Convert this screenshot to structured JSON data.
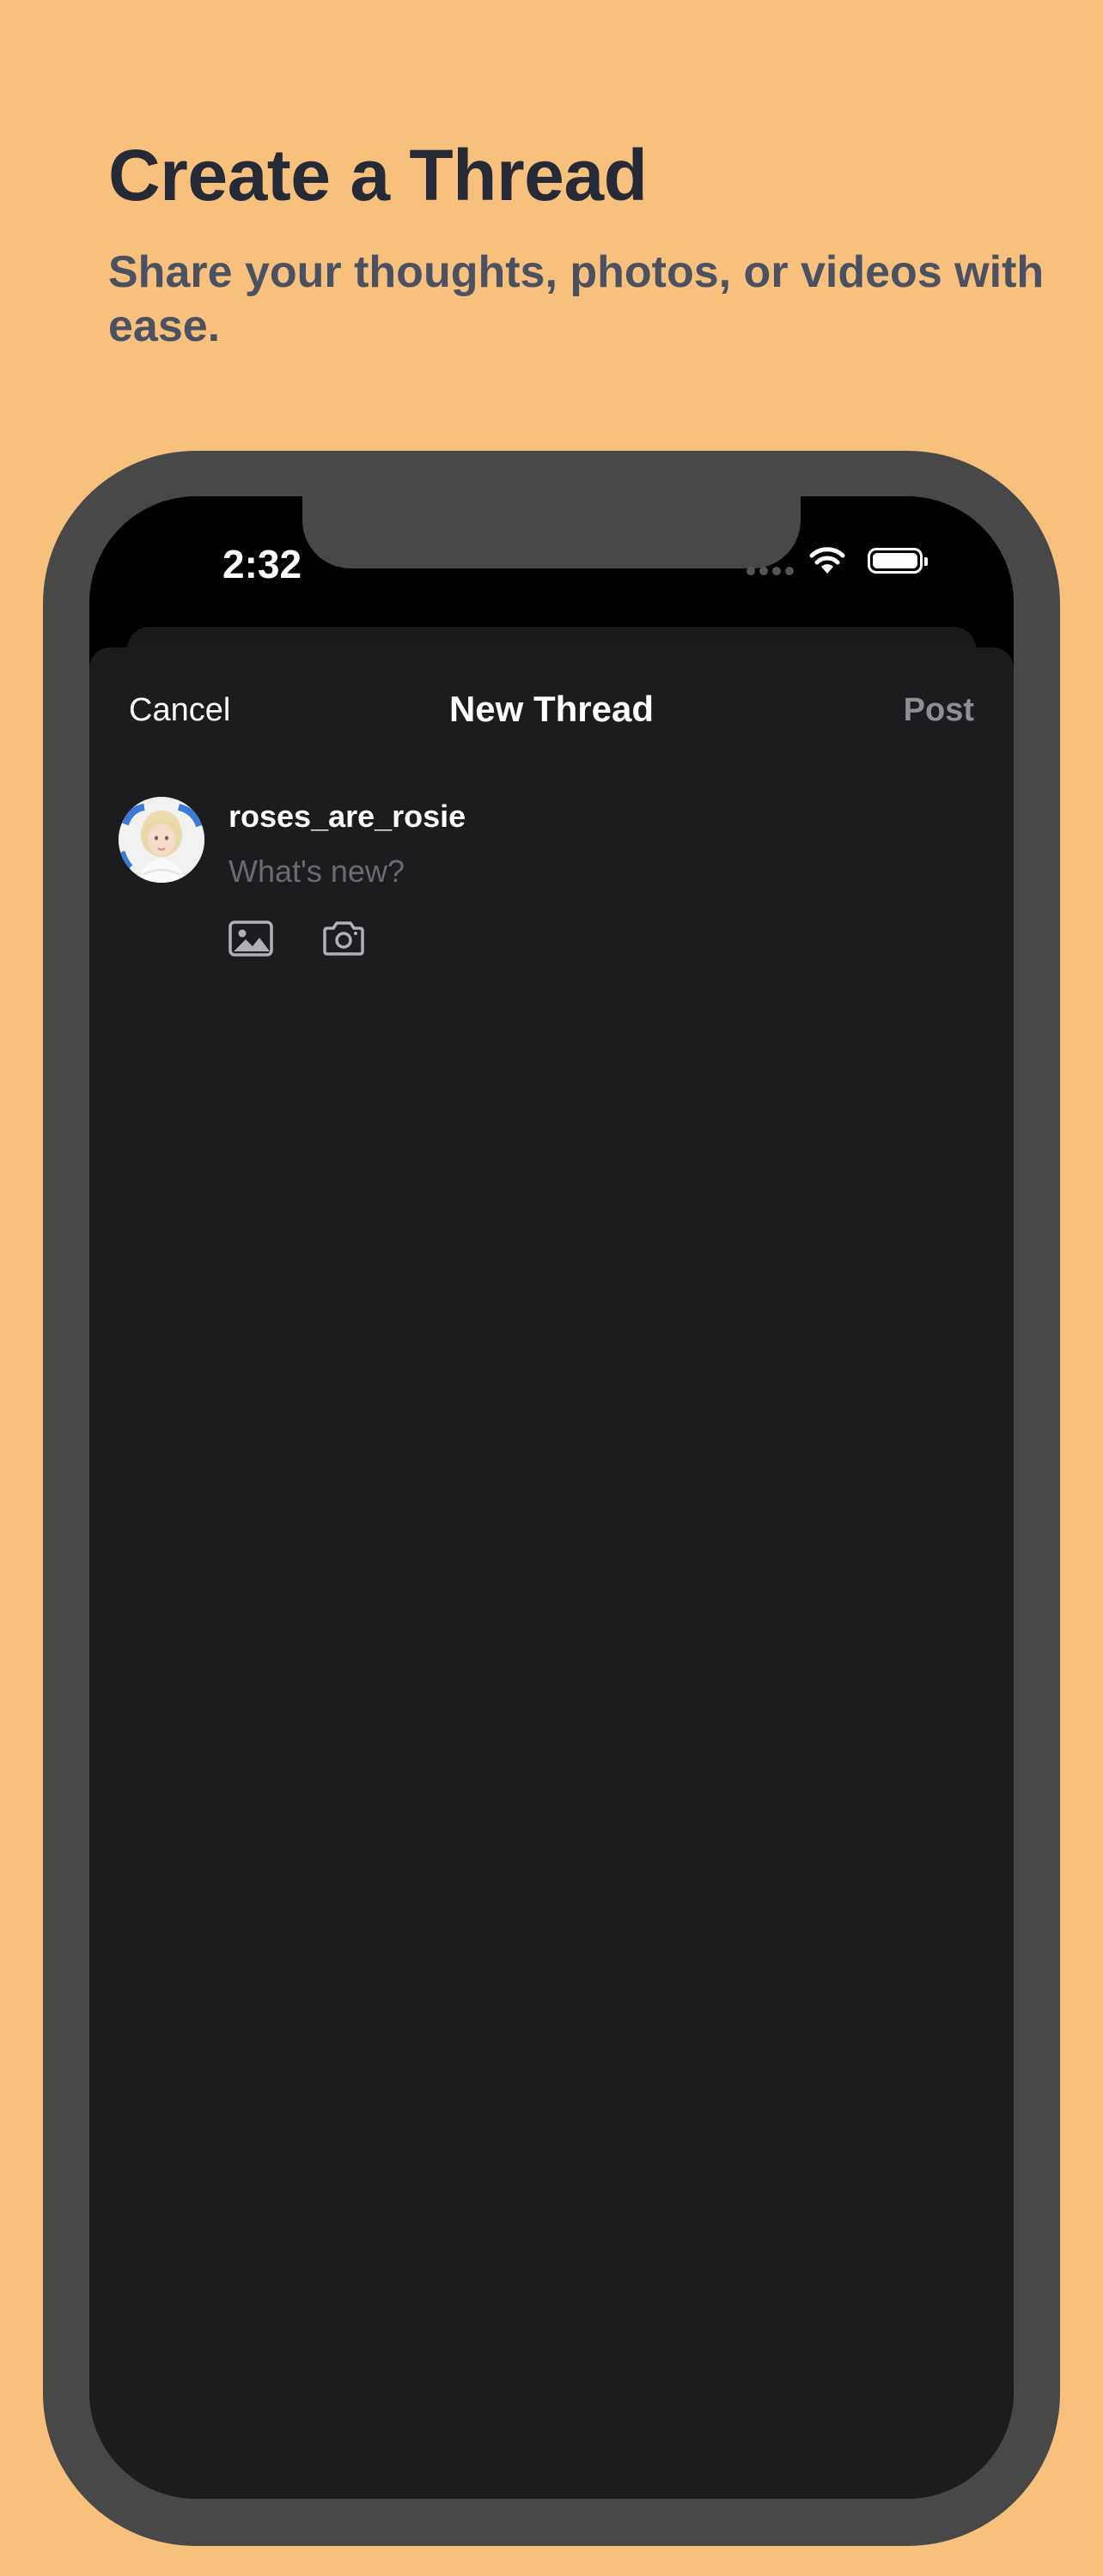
{
  "promo": {
    "headline": "Create a Thread",
    "subheadline": "Share your thoughts, photos, or videos with ease."
  },
  "status_bar": {
    "time": "2:32",
    "icons": [
      "signal-icon",
      "wifi-icon",
      "battery-icon"
    ]
  },
  "compose_sheet": {
    "cancel_label": "Cancel",
    "title": "New Thread",
    "post_label": "Post",
    "username": "roses_are_rosie",
    "input_placeholder": "What's new?",
    "attachment_icons": [
      "photo-library-icon",
      "camera-icon"
    ]
  },
  "colors": {
    "background": "#F7C17D",
    "headline": "#262A36",
    "subheadline": "#4B5160",
    "device_frame": "#484848",
    "sheet": "#1C1C1E",
    "post_disabled": "#8E8E93",
    "placeholder": "#6B6B6F"
  }
}
